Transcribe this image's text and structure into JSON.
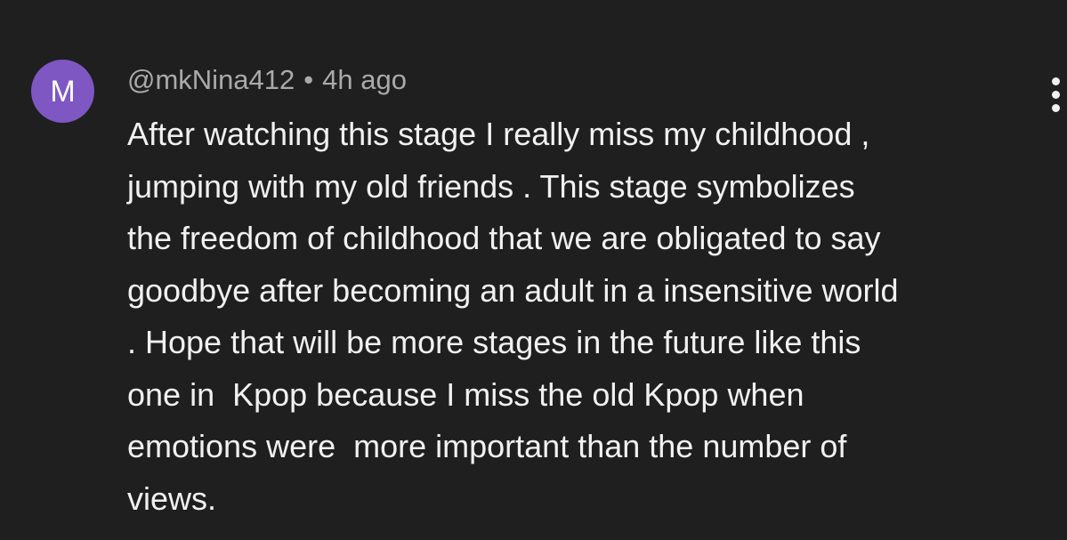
{
  "comment": {
    "avatar_letter": "M",
    "handle": "@mkNina412",
    "separator": "•",
    "timestamp": "4h ago",
    "text_lines": [
      "After watching this stage I really miss my childhood ,",
      "jumping with my old friends . This stage symbolizes",
      "the freedom of childhood that we are obligated to say",
      "goodbye after becoming an adult in a insensitive world",
      ". Hope that will be more stages in the future like this",
      "one in  Kpop because I miss the old Kpop when",
      "emotions were  more important than the number of",
      "views."
    ],
    "more_icon": "vertical-ellipsis-icon",
    "avatar_color": "#7e57c2",
    "background_color": "#1f1f1f"
  }
}
